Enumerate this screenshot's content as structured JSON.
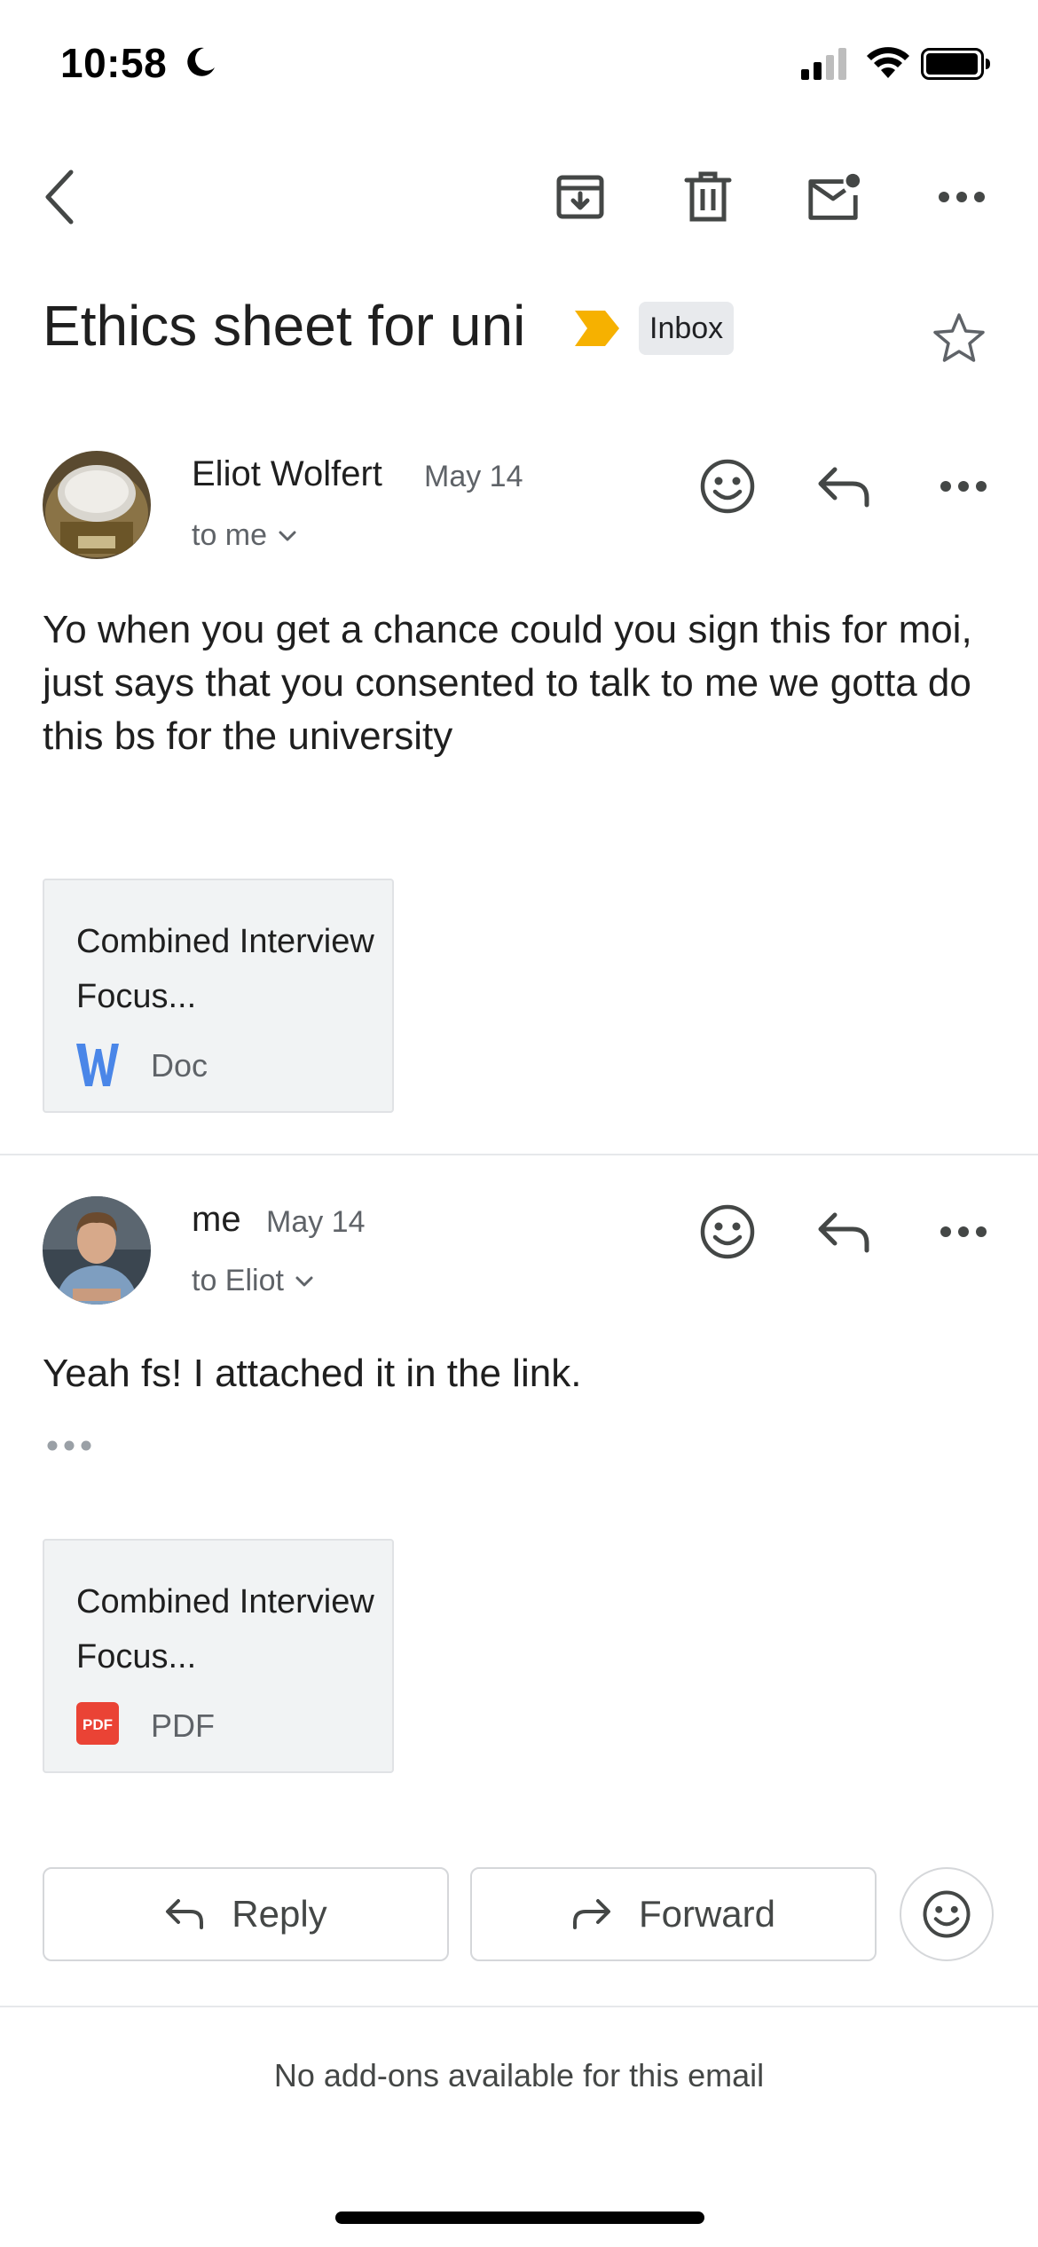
{
  "status_bar": {
    "time": "10:58"
  },
  "thread": {
    "subject": "Ethics sheet for uni",
    "label": "Inbox"
  },
  "messages": [
    {
      "sender": "Eliot Wolfert",
      "date": "May 14",
      "recipient": "to me",
      "body": "Yo when you get a chance could you sign this for moi, just says that you consented to talk to me we gotta do this bs for the university",
      "attachment": {
        "name": "Combined Interview Focus...",
        "type": "Doc"
      }
    },
    {
      "sender": "me",
      "date": "May 14",
      "recipient": "to Eliot",
      "body": "Yeah fs! I attached it in the link.",
      "attachment": {
        "name": "Combined Interview Focus...",
        "type": "PDF"
      }
    }
  ],
  "actions": {
    "reply": "Reply",
    "forward": "Forward"
  },
  "footer": {
    "addons": "No add-ons available for this email"
  },
  "colors": {
    "important_marker": "#f6b100",
    "doc_blue": "#4a86e8",
    "pdf_red": "#ea4335"
  },
  "icons": [
    "back-icon",
    "archive-icon",
    "trash-icon",
    "mark-unread-icon",
    "more-icon",
    "star-icon",
    "emoji-icon",
    "reply-icon",
    "forward-icon"
  ]
}
